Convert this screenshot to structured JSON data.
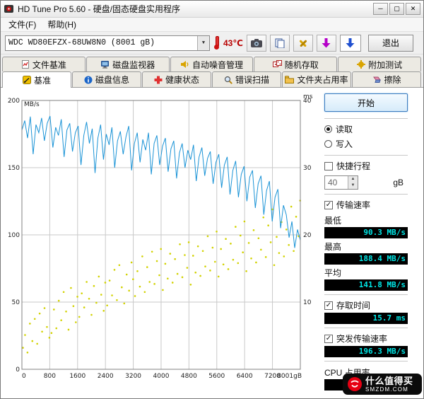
{
  "window": {
    "title": "HD Tune Pro 5.60 - 硬盘/固态硬盘实用程序"
  },
  "menu": {
    "items": [
      {
        "label": "文件(F)"
      },
      {
        "label": "帮助(H)"
      }
    ]
  },
  "toolbar": {
    "drive": "WDC WD80EFZX-68UW8N0 (8001 gB)",
    "temperature": "43℃",
    "exit_label": "退出"
  },
  "tabs": {
    "row1": [
      {
        "label": "文件基准"
      },
      {
        "label": "磁盘监视器"
      },
      {
        "label": "自动噪音管理"
      },
      {
        "label": "随机存取"
      },
      {
        "label": "附加测试"
      }
    ],
    "row2": [
      {
        "label": "基准",
        "selected": true
      },
      {
        "label": "磁盘信息"
      },
      {
        "label": "健康状态"
      },
      {
        "label": "错误扫描"
      },
      {
        "label": "文件夹占用率"
      },
      {
        "label": "擦除"
      }
    ]
  },
  "panel": {
    "start_label": "开始",
    "read_label": "读取",
    "write_label": "写入",
    "shortstroke_label": "快捷行程",
    "shortstroke_value": "40",
    "shortstroke_unit": "gB",
    "transfer_label": "传输速率",
    "min_label": "最低",
    "min_value": "90.3 MB/s",
    "max_label": "最高",
    "max_value": "188.4 MB/s",
    "avg_label": "平均",
    "avg_value": "141.8 MB/s",
    "access_label": "存取时间",
    "access_value": "15.7 ms",
    "burst_label": "突发传输速率",
    "burst_value": "196.3 MB/s",
    "cpu_label": "CPU 占用率",
    "cpu_value": "1.8 %"
  },
  "watermark": {
    "line1": "什么值得买",
    "line2": "SMZDM.COM"
  },
  "chart_data": {
    "type": "line+scatter",
    "title": "",
    "background": "#ffffff",
    "grid_color": "#c9c9c9",
    "plot_border_color": "#808080",
    "x_axis": {
      "min": 0,
      "max": 8001,
      "ticks": [
        0,
        800,
        1600,
        2400,
        3200,
        4000,
        4800,
        5600,
        6400,
        7200
      ],
      "end_label": "8001gB"
    },
    "left_axis": {
      "label": "MB/s",
      "min": 0,
      "max": 200,
      "ticks": [
        50,
        100,
        150,
        200
      ]
    },
    "right_axis": {
      "label": "ms",
      "min": 0,
      "max": 40,
      "ticks": [
        10,
        20,
        30,
        40
      ]
    },
    "series": [
      {
        "name": "传输速率",
        "type": "line",
        "color": "#1a93d6",
        "values": [
          178,
          185,
          172,
          188,
          160,
          182,
          176,
          187,
          170,
          183,
          188.4,
          165,
          180,
          174,
          186,
          158,
          178,
          183,
          162,
          176,
          181,
          152,
          174,
          184,
          168,
          179,
          146,
          172,
          182,
          156,
          175,
          167,
          180,
          150,
          170,
          177,
          160,
          173,
          181,
          148,
          168,
          176,
          154,
          171,
          163,
          176,
          145,
          168,
          174,
          152,
          166,
          172,
          147,
          164,
          170,
          142,
          161,
          168,
          150,
          163,
          156,
          167,
          140,
          158,
          165,
          144,
          157,
          162,
          138,
          154,
          160,
          135,
          152,
          158,
          130,
          148,
          155,
          128,
          145,
          151,
          125,
          143,
          148,
          120,
          138,
          144,
          115,
          133,
          140,
          110,
          128,
          134,
          105,
          122,
          115,
          98,
          110,
          90.3,
          104,
          96
        ]
      },
      {
        "name": "存取时间",
        "type": "scatter",
        "color": "#d2d200",
        "points": [
          [
            30,
            3.2
          ],
          [
            90,
            5.1
          ],
          [
            160,
            2.5
          ],
          [
            230,
            6.8
          ],
          [
            300,
            4.2
          ],
          [
            370,
            7.5
          ],
          [
            440,
            3.8
          ],
          [
            510,
            8.3
          ],
          [
            580,
            5.6
          ],
          [
            650,
            9.1
          ],
          [
            720,
            6.3
          ],
          [
            790,
            4.7
          ],
          [
            850,
            5.4
          ],
          [
            920,
            8.9
          ],
          [
            990,
            6.1
          ],
          [
            1060,
            10.2
          ],
          [
            1130,
            7.3
          ],
          [
            1200,
            11.5
          ],
          [
            1270,
            8.6
          ],
          [
            1340,
            5.9
          ],
          [
            1410,
            12.1
          ],
          [
            1480,
            9.4
          ],
          [
            1550,
            7.0
          ],
          [
            1595,
            10.8
          ],
          [
            1650,
            7.8
          ],
          [
            1720,
            11.3
          ],
          [
            1790,
            9.2
          ],
          [
            1860,
            13.0
          ],
          [
            1930,
            10.5
          ],
          [
            2000,
            8.1
          ],
          [
            2070,
            12.4
          ],
          [
            2140,
            9.9
          ],
          [
            2210,
            13.8
          ],
          [
            2280,
            11.1
          ],
          [
            2350,
            8.7
          ],
          [
            2395,
            12.9
          ],
          [
            2450,
            9.5
          ],
          [
            2520,
            13.2
          ],
          [
            2590,
            11.0
          ],
          [
            2660,
            14.8
          ],
          [
            2730,
            10.3
          ],
          [
            2800,
            15.5
          ],
          [
            2870,
            12.2
          ],
          [
            2940,
            9.8
          ],
          [
            3010,
            14.1
          ],
          [
            3080,
            11.7
          ],
          [
            3150,
            15.9
          ],
          [
            3195,
            13.4
          ],
          [
            3250,
            10.9
          ],
          [
            3320,
            14.6
          ],
          [
            3390,
            12.3
          ],
          [
            3460,
            16.8
          ],
          [
            3530,
            11.5
          ],
          [
            3600,
            15.2
          ],
          [
            3670,
            13.0
          ],
          [
            3740,
            17.5
          ],
          [
            3810,
            12.7
          ],
          [
            3880,
            16.1
          ],
          [
            3950,
            14.0
          ],
          [
            3995,
            17.9
          ],
          [
            4050,
            11.8
          ],
          [
            4120,
            15.7
          ],
          [
            4190,
            13.5
          ],
          [
            4260,
            17.2
          ],
          [
            4330,
            12.9
          ],
          [
            4400,
            16.4
          ],
          [
            4470,
            14.2
          ],
          [
            4540,
            18.6
          ],
          [
            4610,
            13.7
          ],
          [
            4680,
            17.0
          ],
          [
            4750,
            15.1
          ],
          [
            4795,
            18.9
          ],
          [
            4850,
            12.6
          ],
          [
            4920,
            16.9
          ],
          [
            4990,
            14.4
          ],
          [
            5060,
            18.3
          ],
          [
            5130,
            13.9
          ],
          [
            5200,
            17.6
          ],
          [
            5270,
            15.3
          ],
          [
            5340,
            19.8
          ],
          [
            5410,
            14.7
          ],
          [
            5480,
            18.1
          ],
          [
            5550,
            16.0
          ],
          [
            5595,
            20.5
          ],
          [
            5650,
            13.8
          ],
          [
            5720,
            17.9
          ],
          [
            5790,
            15.6
          ],
          [
            5860,
            19.4
          ],
          [
            5930,
            14.9
          ],
          [
            6000,
            18.7
          ],
          [
            6070,
            16.3
          ],
          [
            6140,
            21.2
          ],
          [
            6210,
            15.8
          ],
          [
            6280,
            19.9
          ],
          [
            6350,
            17.4
          ],
          [
            6395,
            22.0
          ],
          [
            6450,
            14.6
          ],
          [
            6520,
            18.8
          ],
          [
            6590,
            16.5
          ],
          [
            6660,
            20.7
          ],
          [
            6730,
            15.9
          ],
          [
            6800,
            19.5
          ],
          [
            6870,
            17.8
          ],
          [
            6940,
            22.6
          ],
          [
            7010,
            16.7
          ],
          [
            7080,
            21.4
          ],
          [
            7150,
            18.9
          ],
          [
            7195,
            23.8
          ],
          [
            7250,
            15.5
          ],
          [
            7320,
            19.7
          ],
          [
            7390,
            17.3
          ],
          [
            7460,
            21.9
          ],
          [
            7530,
            16.8
          ],
          [
            7600,
            20.8
          ],
          [
            7670,
            18.5
          ],
          [
            7740,
            24.2
          ],
          [
            7810,
            17.6
          ],
          [
            7880,
            22.7
          ],
          [
            7950,
            19.8
          ],
          [
            7995,
            25.1
          ]
        ]
      }
    ]
  }
}
